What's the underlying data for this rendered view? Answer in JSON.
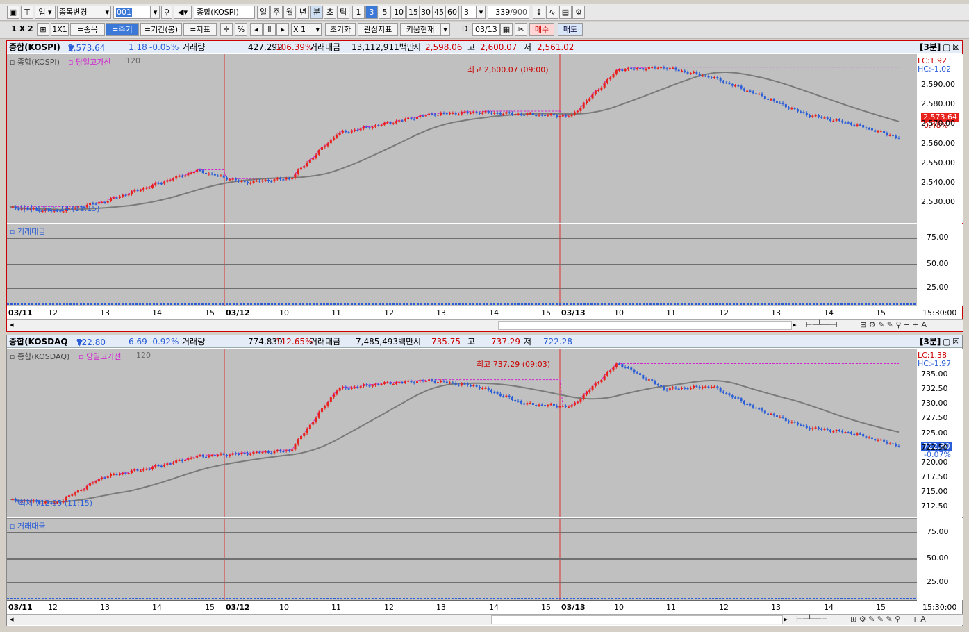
{
  "toolbar1": {
    "market_select": "업",
    "change_item_label": "종목변경",
    "code_input": "001",
    "index_name": "종합(KOSPI)",
    "periods": [
      "일",
      "주",
      "월",
      "년",
      "분",
      "초",
      "틱"
    ],
    "minute_intervals": [
      "1",
      "3",
      "5",
      "10",
      "15",
      "30",
      "45",
      "60"
    ],
    "multiplier": "3",
    "count_display": "339",
    "count_total": "/900"
  },
  "toolbar2": {
    "layout": "1 X 2",
    "single": "1X1",
    "item_btn": "=종목",
    "period_btn": "=주기",
    "range_btn": "=기간(봉)",
    "indicator_btn": "=지표",
    "pct_btn": "%",
    "scale": "X 1",
    "reset_btn": "초기화",
    "watch_btn": "관심지표",
    "kiwoom_btn": "키움현재",
    "date_label": "D",
    "date_value": "03/13",
    "buy_btn": "매수",
    "sell_btn": "매도"
  },
  "colors": {
    "up": "#e8221c",
    "down": "#2b5ed6",
    "high_line": "#d020d0",
    "ma": "#7a7a7a"
  },
  "panels": [
    {
      "id": "kospi",
      "header": {
        "name": "종합(KOSPI)",
        "price": "2,573.64",
        "arrow": "▼",
        "change": "1.18",
        "pct": "-0.05%",
        "vol_label": "거래량",
        "vol": "427,292",
        "vol_ratio": "106.39%",
        "amt_label": "거래대금",
        "amt": "13,112,911백만",
        "open_label": "시",
        "open": "2,598.06",
        "high_label": "고",
        "high": "2,600.07",
        "low_label": "저",
        "low": "2,561.02",
        "interval": "[3분]"
      },
      "legend": {
        "name": "종합(KOSPI)",
        "high_line": "당일고가선",
        "ma": "120"
      },
      "lc": "LC:1.92",
      "hc": "HC:-1.02",
      "max_label": "최고 2,600.07 (09:00)",
      "min_label": "최저 2,525.14 (11:15)",
      "cur_price": "2,573.64",
      "cur_pct": "0.48%",
      "yticks": [
        "2,590.00",
        "2,580.00",
        "2,570.00",
        "2,560.00",
        "2,550.00",
        "2,540.00",
        "2,530.00"
      ],
      "vol_title": "거래대금",
      "vol_ticks": [
        "75.00",
        "50.00",
        "25.00"
      ],
      "xlabels": [
        "03/11",
        "12",
        "13",
        "14",
        "15",
        "03/12",
        "10",
        "11",
        "12",
        "13",
        "14",
        "15",
        "03/13",
        "10",
        "11",
        "12",
        "13",
        "14",
        "15"
      ],
      "time_label": "15:30:00"
    },
    {
      "id": "kosdaq",
      "header": {
        "name": "종합(KOSDAQ",
        "price": "722.80",
        "arrow": "▼",
        "change": "6.69",
        "pct": "-0.92%",
        "vol_label": "거래량",
        "vol": "774,839",
        "vol_ratio": "112.65%",
        "amt_label": "거래대금",
        "amt": "7,485,493백만",
        "open_label": "시",
        "open": "735.75",
        "high_label": "고",
        "high": "737.29",
        "low_label": "저",
        "low": "722.28",
        "interval": "[3분]"
      },
      "legend": {
        "name": "종합(KOSDAQ)",
        "high_line": "당일고가선",
        "ma": "120"
      },
      "lc": "LC:1.38",
      "hc": "HC:-1.97",
      "max_label": "최고 737.29 (09:03)",
      "min_label": "최저 712.95 (11:15)",
      "cur_price": "722.80",
      "cur_pct": "-0.07%",
      "yticks": [
        "735.00",
        "732.50",
        "730.00",
        "727.50",
        "725.00",
        "722.50",
        "720.00",
        "717.50",
        "715.00",
        "712.50"
      ],
      "vol_title": "거래대금",
      "vol_ticks": [
        "75.00",
        "50.00",
        "25.00"
      ],
      "xlabels": [
        "03/11",
        "12",
        "13",
        "14",
        "15",
        "03/12",
        "10",
        "11",
        "12",
        "13",
        "14",
        "15",
        "03/13",
        "10",
        "11",
        "12",
        "13",
        "14",
        "15"
      ],
      "time_label": "15:30:00"
    }
  ],
  "chart_data": [
    {
      "type": "line",
      "title": "종합(KOSPI)",
      "x": [
        "03/11 09",
        "03/11 11:15",
        "03/11 12",
        "03/11 13",
        "03/11 14",
        "03/11 15",
        "03/12 09",
        "03/12 10",
        "03/12 11",
        "03/12 12",
        "03/12 13",
        "03/12 14",
        "03/12 15",
        "03/13 09",
        "03/13 10",
        "03/13 11",
        "03/13 12",
        "03/13 13",
        "03/13 14",
        "03/13 15"
      ],
      "series": [
        {
          "values": [
            2527,
            2525.1,
            2530,
            2538,
            2546,
            2540,
            2542,
            2565,
            2570,
            2575,
            2576,
            2575,
            2574,
            2598,
            2599,
            2594,
            2585,
            2575,
            2570,
            2563
          ]
        }
      ],
      "ylim": [
        2522,
        2603
      ]
    },
    {
      "type": "line",
      "title": "종합(KOSDAQ",
      "x": [
        "03/11 09",
        "03/11 11:15",
        "03/11 12",
        "03/11 13",
        "03/11 14",
        "03/11 15",
        "03/12 09",
        "03/12 10",
        "03/12 11",
        "03/12 12",
        "03/12 13",
        "03/12 14",
        "03/12 15",
        "03/13 09",
        "03/13 10",
        "03/13 11",
        "03/13 12",
        "03/13 13",
        "03/13 14",
        "03/13 15"
      ],
      "series": [
        {
          "values": [
            713.5,
            712.95,
            717.5,
            719,
            721,
            721.5,
            722,
            732.5,
            733.5,
            734,
            733,
            730,
            729.5,
            737,
            732.5,
            733,
            729,
            726,
            725,
            722.8
          ]
        }
      ],
      "ylim": [
        711.5,
        738.5
      ]
    }
  ]
}
